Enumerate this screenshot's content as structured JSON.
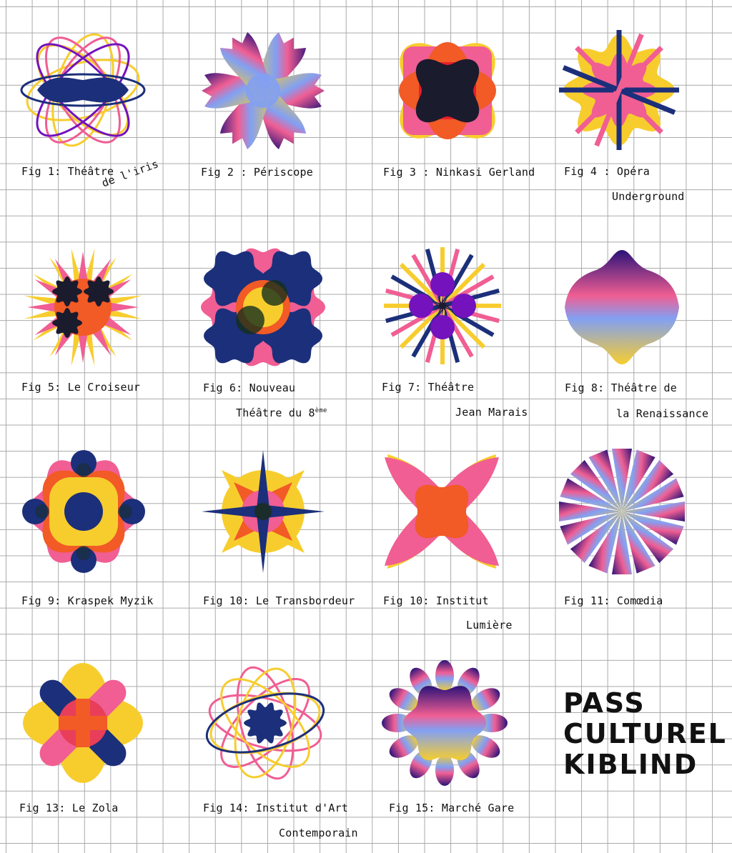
{
  "title": {
    "line1": "PASS",
    "line2": "CULTUREL",
    "line3": "KIBLIND"
  },
  "colors": {
    "yellow": "#f7cd2e",
    "pink": "#f05e93",
    "orange": "#f25a26",
    "navy": "#1c2f7a",
    "purple": "#7412bd",
    "dark": "#1b1b2e",
    "blue": "#82a0f3"
  },
  "figures": [
    {
      "label1": "Fig 1: Théâtre",
      "label2": "de l'iris"
    },
    {
      "label1": "Fig 2 : Périscope"
    },
    {
      "label1": "Fig 3 : Ninkasi Gerland"
    },
    {
      "label1": "Fig 4 : Opéra",
      "label2": "Underground"
    },
    {
      "label1": "Fig 5: Le Croiseur"
    },
    {
      "label1": "Fig 6: Nouveau",
      "label2": "Théâtre du 8",
      "sup": "ème"
    },
    {
      "label1": "Fig 7: Théâtre",
      "label2": "Jean Marais"
    },
    {
      "label1": "Fig 8: Théâtre de",
      "label2": "la Renaissance"
    },
    {
      "label1": "Fig 9: Kraspek Myzik"
    },
    {
      "label1": "Fig 10: Le Transbordeur"
    },
    {
      "label1": "Fig 10:  Institut",
      "label2": "Lumière"
    },
    {
      "label1": "Fig 11: Comœdia"
    },
    {
      "label1": "Fig 13: Le Zola"
    },
    {
      "label1": "Fig 14: Institut d'Art",
      "label2": "Contemporain"
    },
    {
      "label1": "Fig 15: Marché Gare"
    }
  ]
}
